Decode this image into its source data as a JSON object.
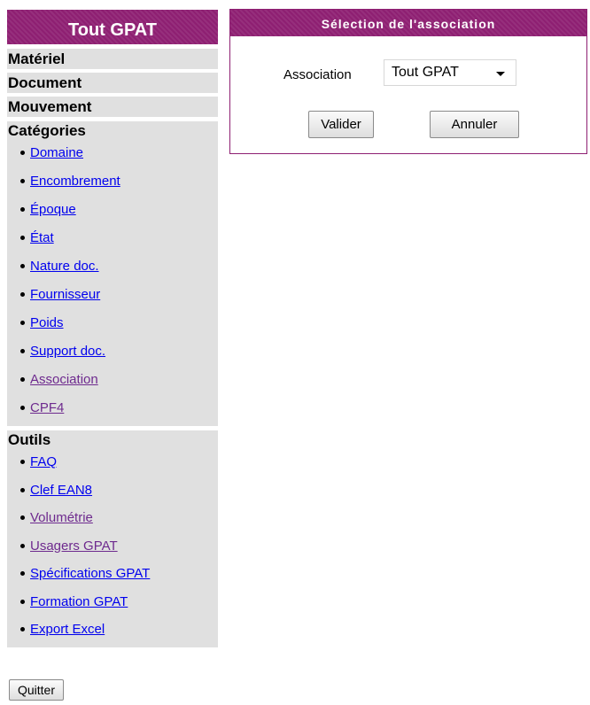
{
  "sidebar": {
    "brand": "Tout GPAT",
    "nav": [
      "Matériel",
      "Document",
      "Mouvement"
    ],
    "categories": {
      "title": "Catégories",
      "items": [
        "Domaine",
        "Encombrement",
        "Époque",
        "État",
        "Nature doc.",
        "Fournisseur",
        "Poids",
        "Support doc.",
        "Association",
        "CPF4"
      ]
    },
    "tools": {
      "title": "Outils",
      "items": [
        "FAQ",
        "Clef EAN8",
        "Volumétrie",
        "Usagers GPAT",
        "Spécifications GPAT",
        "Formation GPAT",
        "Export Excel"
      ]
    },
    "quit_label": "Quitter"
  },
  "dialog": {
    "title": "Sélection de l'association",
    "field_label": "Association",
    "selected": "Tout GPAT",
    "ok_label": "Valider",
    "cancel_label": "Annuler"
  },
  "colors": {
    "accent": "#8e1f72",
    "panel": "#e0e0e0",
    "link": "#0000ee",
    "visited_link": "#6e2a8e"
  }
}
